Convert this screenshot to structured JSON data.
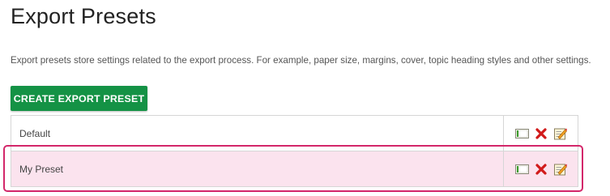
{
  "page": {
    "title": "Export Presets",
    "description": "Export presets store settings related to the export process. For example, paper size, margins, cover, topic heading styles and other settings."
  },
  "toolbar": {
    "create_label": "CREATE EXPORT PRESET"
  },
  "presets": [
    {
      "name": "Default",
      "highlighted": false,
      "icons": [
        "apply-preset-icon",
        "delete-icon",
        "edit-icon"
      ]
    },
    {
      "name": "My Preset",
      "highlighted": true,
      "icons": [
        "apply-preset-icon",
        "delete-icon",
        "edit-icon"
      ]
    }
  ],
  "colors": {
    "create_button": "#149245",
    "highlight_border": "#d3276a",
    "highlight_fill": "#fbe3ee",
    "delete_icon": "#d11a1a"
  }
}
